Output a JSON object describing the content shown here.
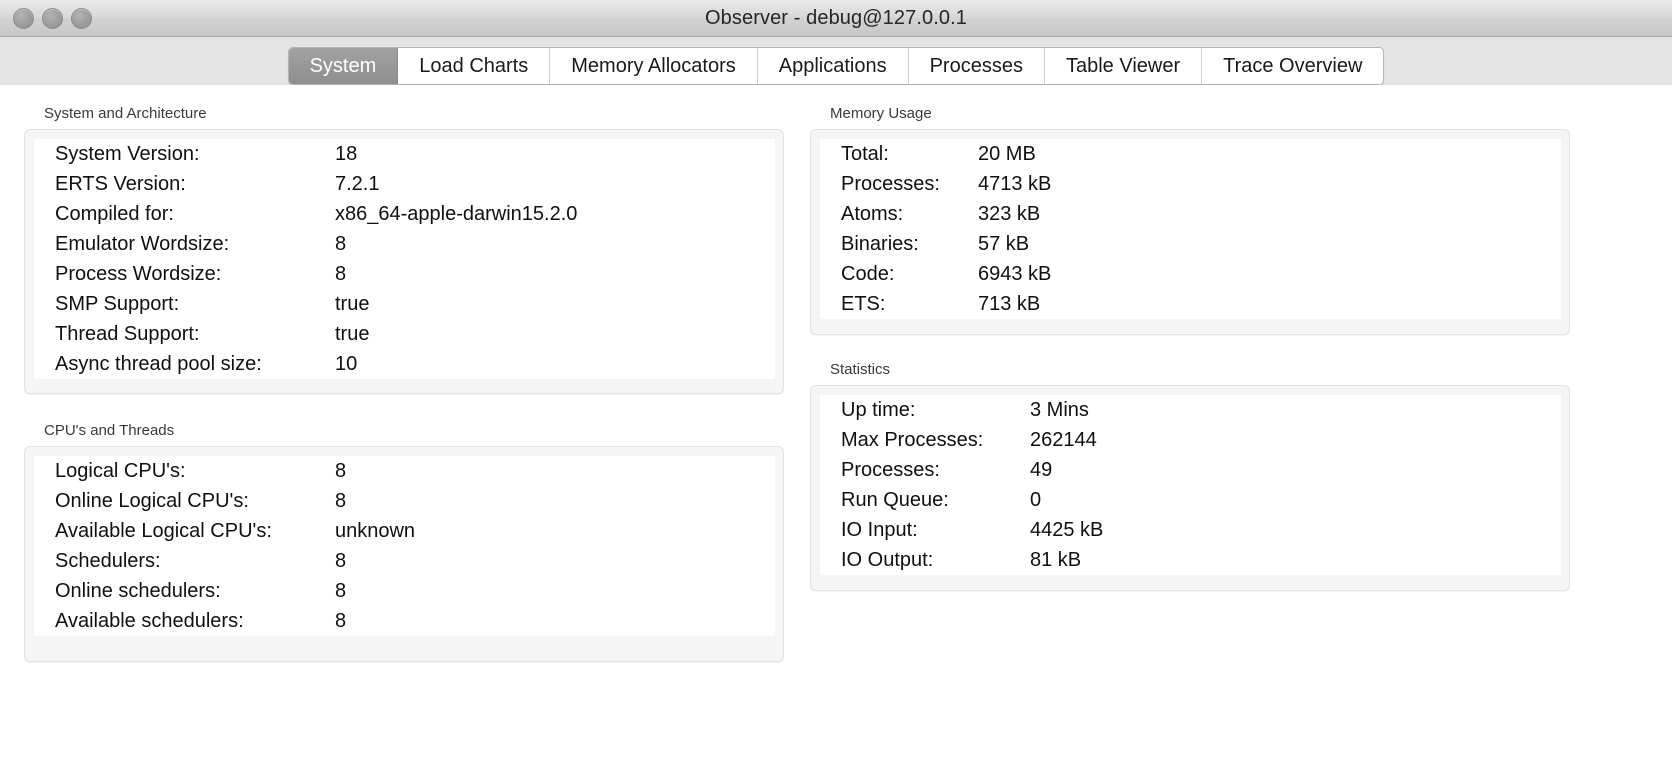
{
  "window": {
    "title": "Observer - debug@127.0.0.1",
    "traffic_lights": [
      "close-button",
      "minimize-button",
      "zoom-button"
    ]
  },
  "tabs": [
    {
      "label": "System",
      "selected": true
    },
    {
      "label": "Load Charts",
      "selected": false
    },
    {
      "label": "Memory Allocators",
      "selected": false
    },
    {
      "label": "Applications",
      "selected": false
    },
    {
      "label": "Processes",
      "selected": false
    },
    {
      "label": "Table Viewer",
      "selected": false
    },
    {
      "label": "Trace Overview",
      "selected": false
    }
  ],
  "panels": {
    "system_architecture": {
      "title": "System and Architecture",
      "rows": [
        {
          "key": "System Version:",
          "value": "18"
        },
        {
          "key": "ERTS Version:",
          "value": "7.2.1"
        },
        {
          "key": "Compiled for:",
          "value": "x86_64-apple-darwin15.2.0"
        },
        {
          "key": "Emulator Wordsize:",
          "value": "8"
        },
        {
          "key": "Process Wordsize:",
          "value": "8"
        },
        {
          "key": "SMP Support:",
          "value": "true"
        },
        {
          "key": "Thread Support:",
          "value": "true"
        },
        {
          "key": "Async thread pool size:",
          "value": "10"
        }
      ]
    },
    "cpus_and_threads": {
      "title": "CPU's and Threads",
      "rows": [
        {
          "key": "Logical CPU's:",
          "value": "8"
        },
        {
          "key": "Online Logical CPU's:",
          "value": "8"
        },
        {
          "key": "Available Logical CPU's:",
          "value": "unknown"
        },
        {
          "key": "Schedulers:",
          "value": "8"
        },
        {
          "key": "Online schedulers:",
          "value": "8"
        },
        {
          "key": "Available schedulers:",
          "value": "8"
        }
      ]
    },
    "memory_usage": {
      "title": "Memory Usage",
      "rows": [
        {
          "key": "Total:",
          "value": "20 MB"
        },
        {
          "key": "Processes:",
          "value": "4713 kB"
        },
        {
          "key": "Atoms:",
          "value": "323 kB"
        },
        {
          "key": "Binaries:",
          "value": "57 kB"
        },
        {
          "key": "Code:",
          "value": "6943 kB"
        },
        {
          "key": "ETS:",
          "value": "713 kB"
        }
      ]
    },
    "statistics": {
      "title": "Statistics",
      "rows": [
        {
          "key": "Up time:",
          "value": "3 Mins"
        },
        {
          "key": "Max Processes:",
          "value": "262144"
        },
        {
          "key": "Processes:",
          "value": "49"
        },
        {
          "key": "Run Queue:",
          "value": "0"
        },
        {
          "key": "IO Input:",
          "value": "4425 kB"
        },
        {
          "key": "IO Output:",
          "value": "81 kB"
        }
      ]
    }
  }
}
